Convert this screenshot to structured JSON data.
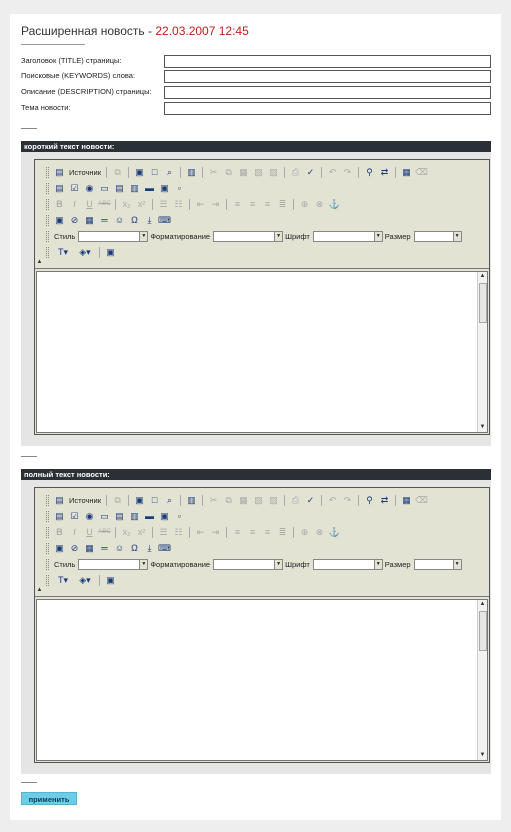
{
  "page": {
    "title_text": "Расширенная новость - ",
    "title_date": "22.03.2007 12:45"
  },
  "fields": [
    {
      "label": "Заголовок (TITLE) страницы:",
      "value": ""
    },
    {
      "label": "Поисковые (KEYWORDS) слова:",
      "value": ""
    },
    {
      "label": "Описание (DESCRIPTION) страницы:",
      "value": ""
    },
    {
      "label": "Тема новости:",
      "value": ""
    }
  ],
  "sections": [
    {
      "header": "короткий текст новости:"
    },
    {
      "header": "полный текст новости:"
    }
  ],
  "editor_toolbar": {
    "source_label": "Источник",
    "style_label": "Стиль",
    "format_label": "Форматирование",
    "font_label": "Шрифт",
    "size_label": "Размер",
    "style_value": "",
    "format_value": "",
    "font_value": "",
    "size_value": "",
    "icons": {
      "source": "source-doc-icon",
      "save": "save-icon",
      "new_page": "new-page-icon",
      "preview": "preview-icon",
      "templates": "templates-icon",
      "cut": "cut-icon",
      "copy": "copy-icon",
      "paste": "paste-icon",
      "paste_text": "paste-text-icon",
      "paste_word": "paste-word-icon",
      "print": "print-icon",
      "spellcheck": "spellcheck-icon",
      "undo": "undo-icon",
      "redo": "redo-icon",
      "find": "find-icon",
      "replace": "replace-icon",
      "select_all": "select-all-icon",
      "remove_format": "remove-format-icon"
    }
  },
  "submit": {
    "label": "применить"
  },
  "colors": {
    "date": "#c41a1a",
    "section_bar": "#2b2f36",
    "editor_bg": "#e3e3d3",
    "apply_button": "#6ecde6"
  }
}
